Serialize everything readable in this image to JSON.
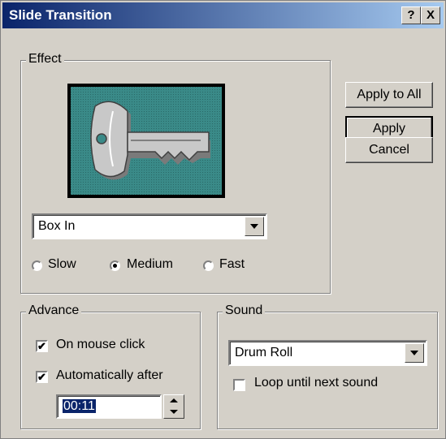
{
  "window": {
    "title": "Slide Transition",
    "help_btn": "?",
    "close_btn": "X"
  },
  "buttons": {
    "apply_to_all": "Apply to All",
    "apply": "Apply",
    "cancel": "Cancel"
  },
  "effect": {
    "legend": "Effect",
    "preview_icon": "key-icon",
    "selected": "Box In",
    "speed": {
      "options": [
        "Slow",
        "Medium",
        "Fast"
      ],
      "selected": "Medium"
    }
  },
  "advance": {
    "legend": "Advance",
    "on_mouse_click": {
      "label": "On mouse click",
      "checked": true
    },
    "auto_after": {
      "label": "Automatically after",
      "checked": true
    },
    "time": "00:11"
  },
  "sound": {
    "legend": "Sound",
    "selected": "Drum Roll",
    "loop": {
      "label": "Loop until next sound",
      "checked": false
    }
  },
  "colors": {
    "titlebar": "#0a246a",
    "preview_bg": "#3a8a88",
    "face": "#d4d0c8"
  }
}
